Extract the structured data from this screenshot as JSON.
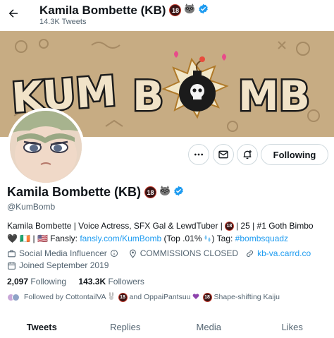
{
  "header": {
    "name": "Kamila Bombette (KB)",
    "badge_18": "18",
    "tweet_count": "14.3K Tweets"
  },
  "banner": {
    "logo_text": "KUMBOMB"
  },
  "actions": {
    "following_label": "Following"
  },
  "profile": {
    "name": "Kamila Bombette (KB)",
    "badge_18": "18",
    "handle": "@KumBomb",
    "bio_line1_a": "Kamila Bombette | Voice Actress, SFX Gal & LewdTuber |",
    "bio_line1_badge": "18",
    "bio_line1_b": "| 25 | #1 Goth Bimbo",
    "bio_line2_flags": "🖤 🇮🇪 | 🇺🇸",
    "bio_line2_fansly_label": "Fansly:",
    "bio_line2_fansly_link": "fansly.com/KumBomb",
    "bio_line2_after": "(Top .01%",
    "bio_line2_tag_label": ") Tag:",
    "bio_line2_tag": "#bombsquadz"
  },
  "meta": {
    "category": "Social Media Influencer",
    "location": "COMMISSIONS CLOSED",
    "website": "kb-va.carrd.co",
    "joined": "Joined September 2019"
  },
  "stats": {
    "following_count": "2,097",
    "following_label": "Following",
    "followers_count": "143.3K",
    "followers_label": "Followers"
  },
  "followed_by": {
    "prefix": "Followed by CottontailVA",
    "badge": "18",
    "middle": "and OppaiPantsuu",
    "badge2": "18",
    "suffix": "Shape-shifting Kaiju"
  },
  "tabs": [
    "Tweets",
    "Replies",
    "Media",
    "Likes"
  ],
  "colors": {
    "accent": "#1d9bf0",
    "banner_bg": "#c9b08a",
    "text_secondary": "#536471"
  }
}
